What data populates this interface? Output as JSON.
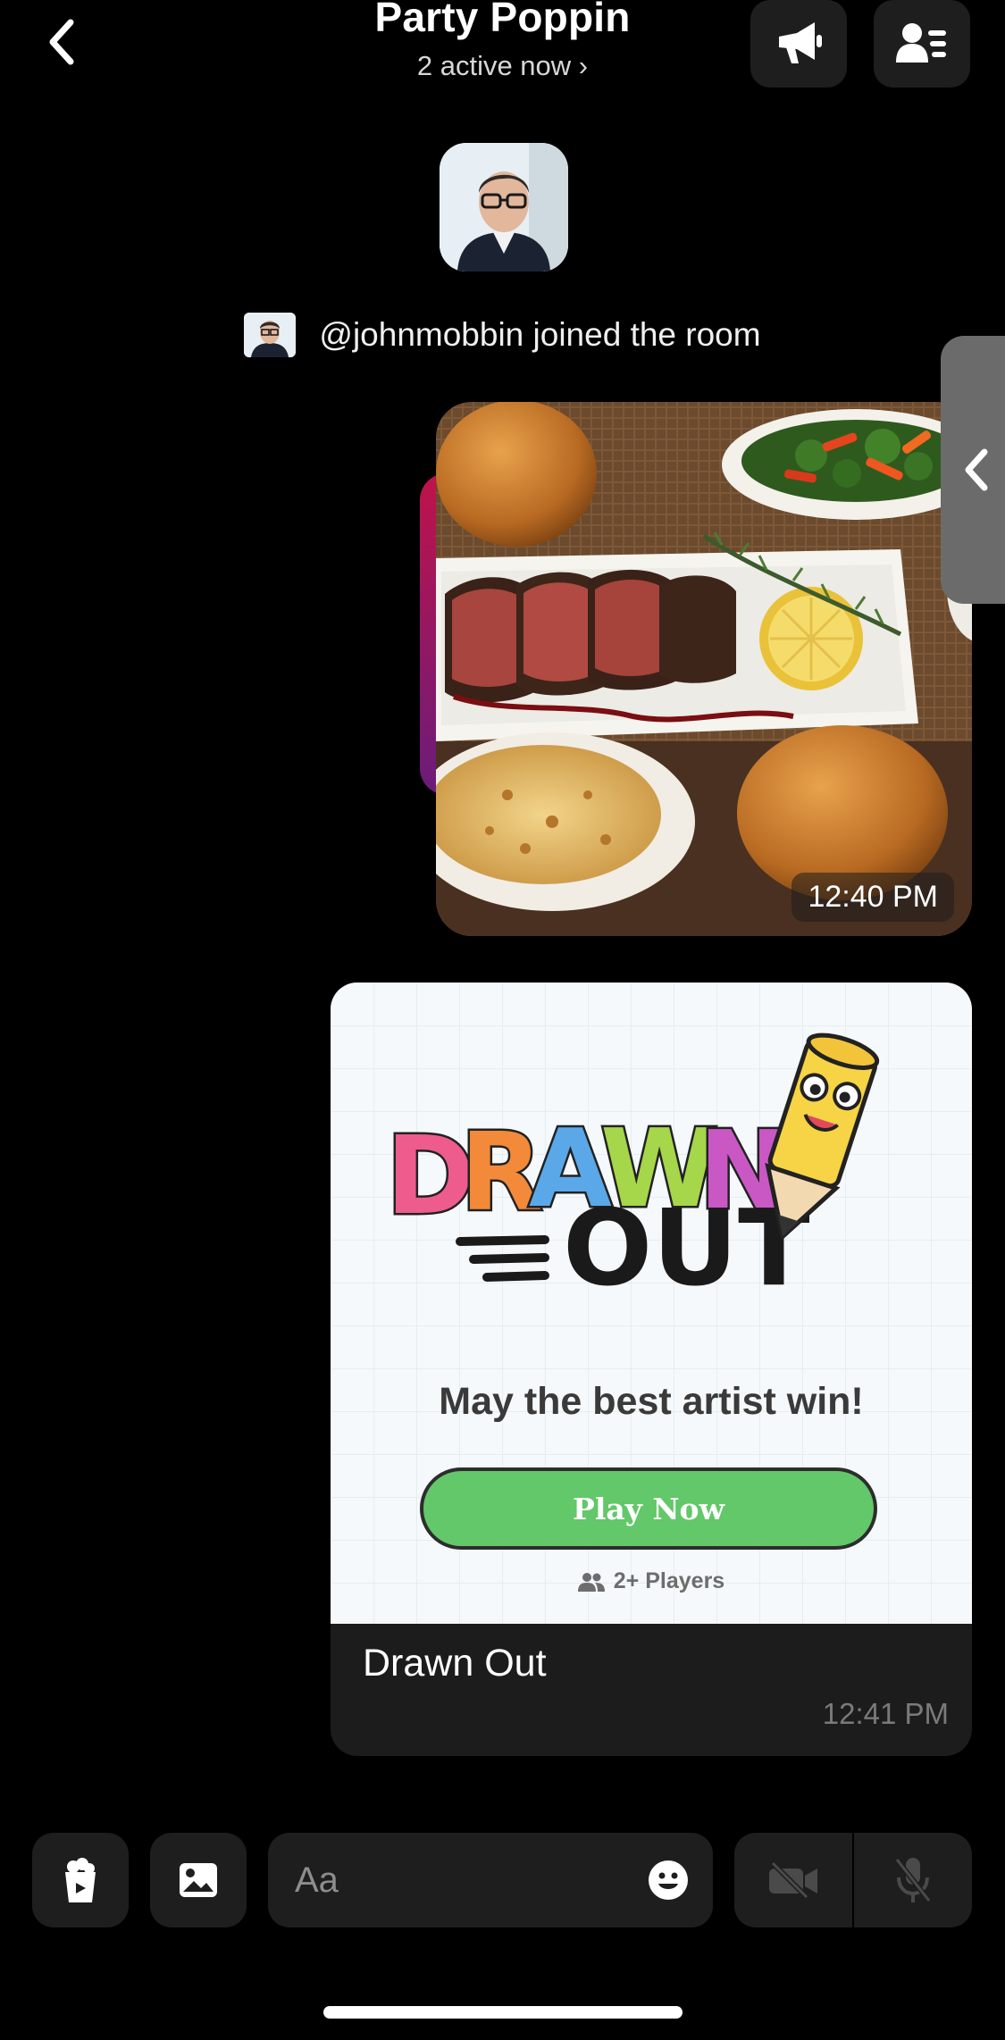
{
  "header": {
    "title": "Party Poppin",
    "subtitle": "2 active now ›",
    "back_icon": "chevron-left-icon",
    "announce_icon": "megaphone-icon",
    "members_icon": "members-list-icon"
  },
  "room": {
    "join_message": "@johnmobbin joined the room"
  },
  "messages": {
    "photo_time": "12:40 PM",
    "game": {
      "logo_line1": "DRAWN",
      "logo_line2": "OUT",
      "tagline": "May the best artist win!",
      "play_label": "Play Now",
      "players_label": "2+ Players",
      "name": "Drawn Out",
      "time": "12:41 PM"
    }
  },
  "composer": {
    "placeholder": "Aa",
    "cup_icon": "popcorn-cup-icon",
    "image_icon": "image-icon",
    "emoji_icon": "emoji-icon",
    "video_icon": "video-off-icon",
    "mic_icon": "mic-off-icon"
  },
  "colors": {
    "background": "#000000",
    "play_button": "#62c869",
    "surface": "#1e1e1e"
  }
}
